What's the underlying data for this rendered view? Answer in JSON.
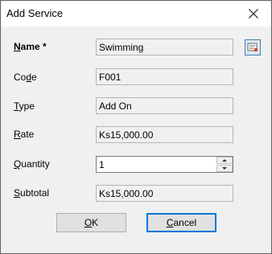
{
  "window": {
    "title": "Add Service",
    "close_icon": "close-icon"
  },
  "form": {
    "name": {
      "label_pre": "",
      "label_mn": "N",
      "label_post": "ame *",
      "value": "Swimming"
    },
    "code": {
      "label_pre": "Co",
      "label_mn": "d",
      "label_post": "e",
      "value": "F001"
    },
    "type": {
      "label_pre": "",
      "label_mn": "T",
      "label_post": "ype",
      "value": "Add On"
    },
    "rate": {
      "label_pre": "",
      "label_mn": "R",
      "label_post": "ate",
      "value": "Ks15,000.00"
    },
    "quantity": {
      "label_pre": "",
      "label_mn": "Q",
      "label_post": "uantity",
      "value": "1"
    },
    "subtotal": {
      "label_pre": "",
      "label_mn": "S",
      "label_post": "ubtotal",
      "value": "Ks15,000.00"
    }
  },
  "buttons": {
    "ok": {
      "mn": "O",
      "rest": "K"
    },
    "cancel": {
      "mn": "C",
      "rest": "ancel"
    }
  },
  "icons": {
    "lookup": "lookup-icon",
    "spin_up": "spin-up-icon",
    "spin_down": "spin-down-icon"
  }
}
